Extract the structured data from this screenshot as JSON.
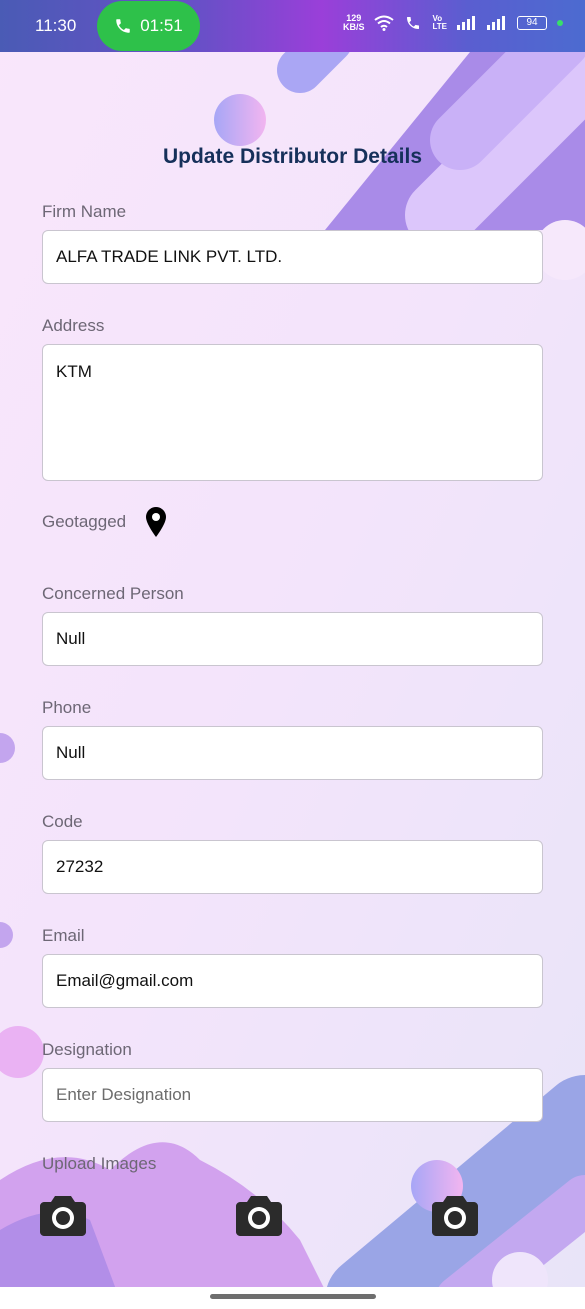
{
  "status_bar": {
    "time": "11:30",
    "call_timer": "01:51",
    "net_speed_value": "129",
    "net_speed_unit": "KB/S",
    "volte_top": "Vo",
    "volte_bottom": "LTE",
    "battery": "94"
  },
  "form": {
    "title": "Update Distributor Details",
    "firm_name": {
      "label": "Firm Name",
      "value": "ALFA TRADE LINK PVT. LTD."
    },
    "address": {
      "label": "Address",
      "value": "KTM"
    },
    "geotag": {
      "label": "Geotagged",
      "icon": "location-pin-icon"
    },
    "concerned_person": {
      "label": "Concerned Person",
      "value": "Null"
    },
    "phone": {
      "label": "Phone",
      "value": "Null"
    },
    "code": {
      "label": "Code",
      "value": "27232"
    },
    "email": {
      "label": "Email",
      "value": "Email@gmail.com"
    },
    "designation": {
      "label": "Designation",
      "placeholder": "Enter Designation"
    },
    "upload": {
      "label": "Upload Images",
      "icons": [
        "camera-icon",
        "camera-icon",
        "camera-icon"
      ]
    }
  },
  "colors": {
    "title": "#16305a",
    "label": "#6d6775",
    "call_pill": "#2ec14a",
    "background": "#f6e8fb"
  }
}
